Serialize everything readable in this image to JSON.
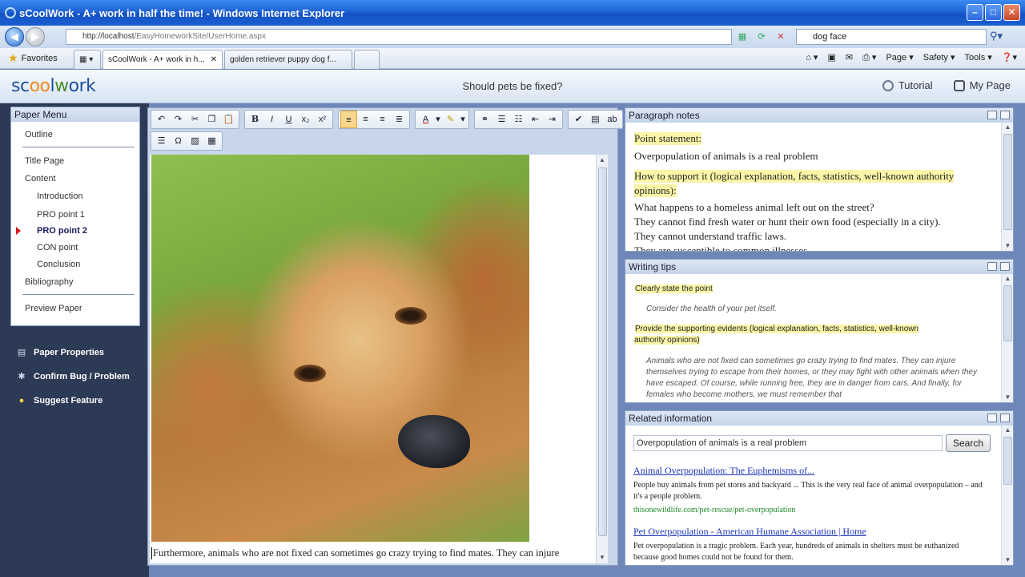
{
  "browser": {
    "window_title": "sCoolWork - A+ work in half the time! - Windows Internet Explorer",
    "url_host": "http://localhost",
    "url_path": "/EasyHomeworkSite/UserHome.aspx",
    "search_query": "dog face",
    "favorites_label": "Favorites",
    "tabs": [
      {
        "label": "sCoolWork - A+ work in h..."
      },
      {
        "label": "golden retriever puppy dog f..."
      }
    ],
    "commands": [
      "Page ▾",
      "Safety ▾",
      "Tools ▾"
    ]
  },
  "app": {
    "logo_parts": [
      "sc",
      "oo",
      "l",
      "w",
      "ork"
    ],
    "topic": "Should pets be fixed?",
    "tutorial_label": "Tutorial",
    "mypage_label": "My Page"
  },
  "paper_menu": {
    "title": "Paper Menu",
    "outline": "Outline",
    "title_page": "Title Page",
    "content": "Content",
    "introduction": "Introduction",
    "pro1": "PRO point 1",
    "pro2": "PRO point 2",
    "con": "CON point",
    "conclusion": "Conclusion",
    "bibliography": "Bibliography",
    "preview": "Preview Paper"
  },
  "side_links": {
    "properties": "Paper Properties",
    "bug": "Confirm Bug / Problem",
    "suggest": "Suggest Feature"
  },
  "editor": {
    "text": "Furthermore, animals who are not fixed can sometimes go crazy trying to find mates. They can injure"
  },
  "notes": {
    "title": "Paragraph notes",
    "point_label": "Point statement:",
    "point_text": "Overpopulation of animals is a real problem",
    "support_label_1": "How to support it (logical explanation, facts, statistics, well-known authority",
    "support_label_2": "opinions):",
    "line1": "What happens to a homeless animal left out on the street?",
    "line2": "They cannot find fresh water or hunt their own food (especially in a city).",
    "line3": "They cannot understand traffic laws.",
    "line4": "They are susceptible to common illnesses."
  },
  "tips": {
    "title": "Writing tips",
    "h1": "Clearly state the point",
    "t1": "Consider the health of your pet itself.",
    "h2a": "Provide the supporting evidents (logical explanation, facts, statistics, well-known",
    "h2b": "authority opinions)",
    "t2": "Animals who are not fixed can sometimes go crazy trying to find mates. They can injure themselves trying to escape from their homes, or they may fight with other animals when they have escaped. Of course, while running free, they are in danger from cars. And finally, for females who become mothers, we must remember that"
  },
  "related": {
    "title": "Related information",
    "query": "Overpopulation of animals is a real problem",
    "search_btn": "Search",
    "r1_title": "Animal Overpopulation: The Euphemisms of...",
    "r1_snip": "People buy animals from pet stores and backyard ... This is the very real face of animal overpopulation – and it's a people problem.",
    "r1_url": "thisonewildlife.com/pet-rescue/pet-overpopulation",
    "r2_title": "Pet Overpopulation - American Humane Association | Home",
    "r2_snip": "Pet overpopulation is a tragic problem. Each year, hundreds of animals in shelters must be euthanized because good homes could not be found for them."
  }
}
